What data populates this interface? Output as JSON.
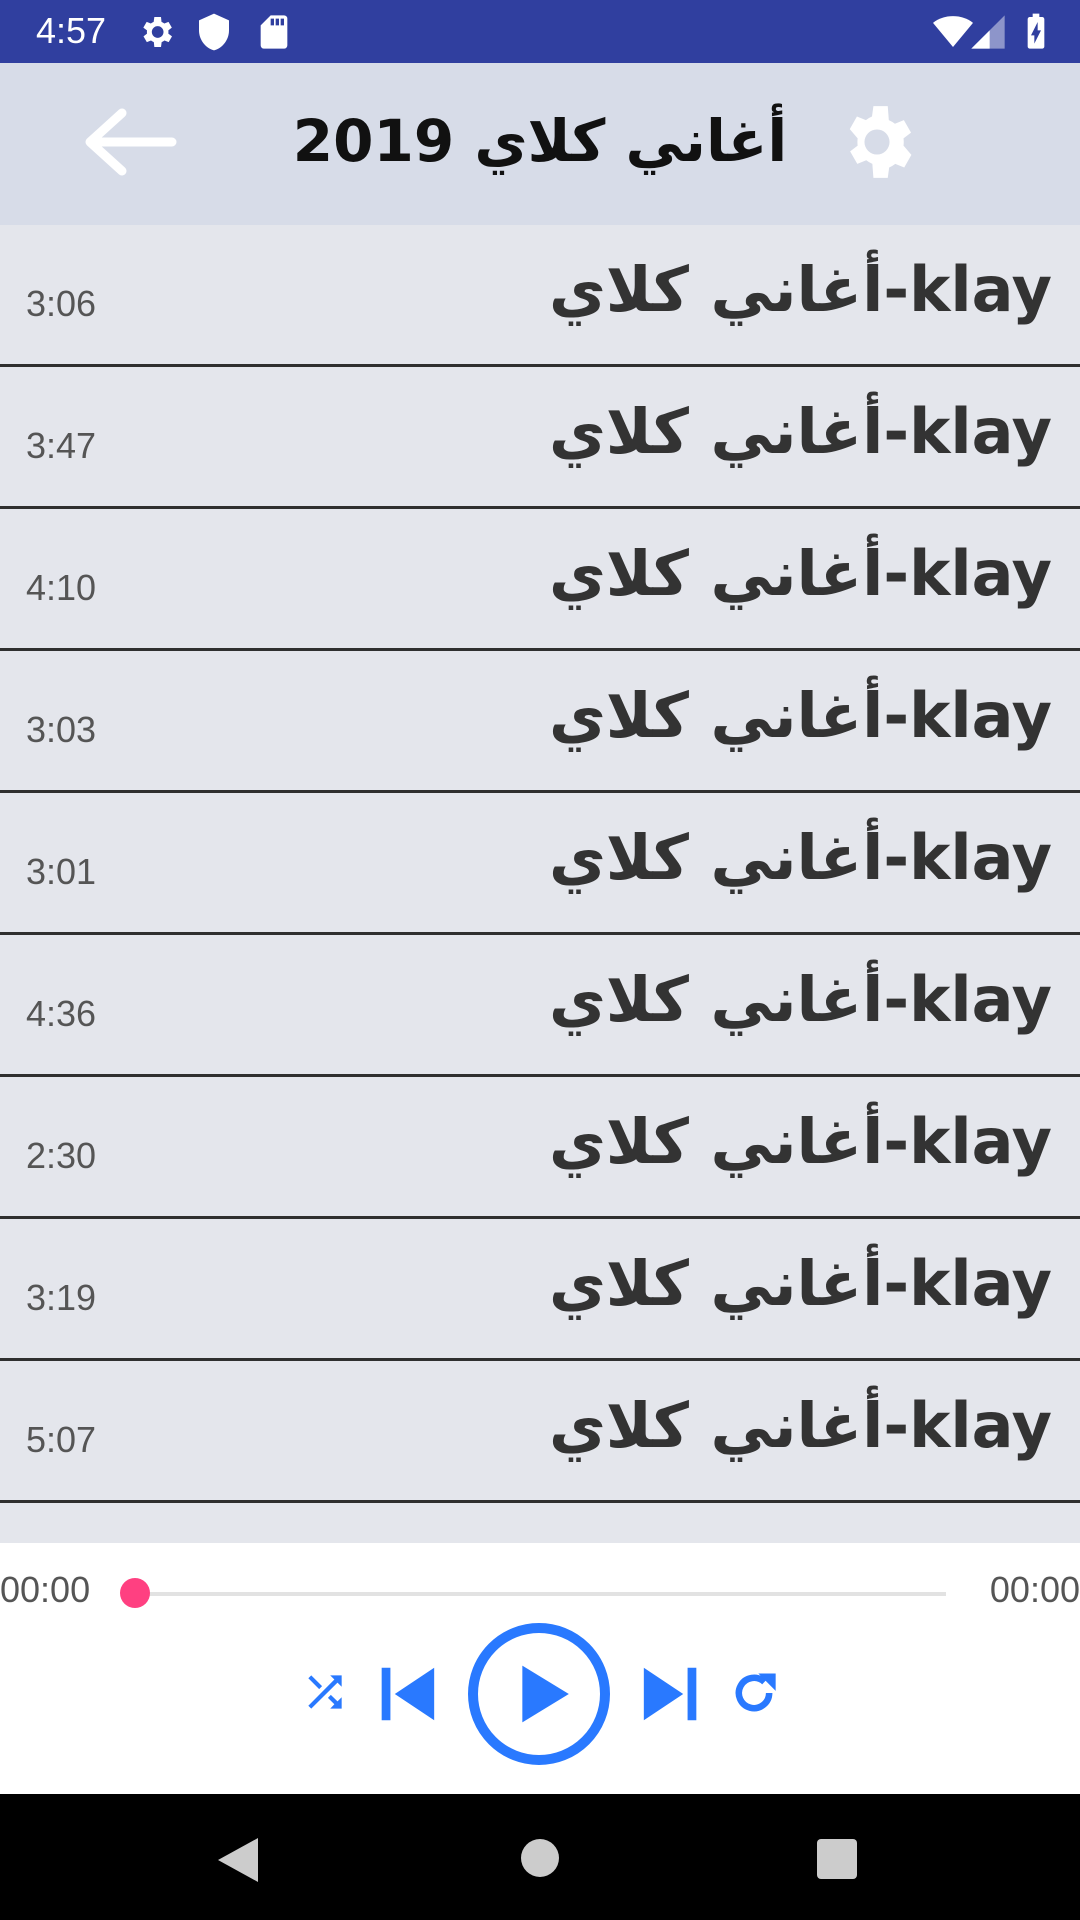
{
  "status_bar": {
    "time": "4:57",
    "icons": [
      "gear-icon",
      "shield-icon",
      "sd-card-icon",
      "wifi-icon",
      "signal-icon",
      "battery-icon"
    ]
  },
  "app_bar": {
    "title": "أغاني كلاي 2019",
    "back_icon": "arrow-left-icon",
    "settings_icon": "gear-icon"
  },
  "tracks": [
    {
      "title": "klay-أغاني كلاي",
      "duration": "3:06"
    },
    {
      "title": "klay-أغاني كلاي",
      "duration": "3:47"
    },
    {
      "title": "klay-أغاني كلاي",
      "duration": "4:10"
    },
    {
      "title": "klay-أغاني كلاي",
      "duration": "3:03"
    },
    {
      "title": "klay-أغاني كلاي",
      "duration": "3:01"
    },
    {
      "title": "klay-أغاني كلاي",
      "duration": "4:36"
    },
    {
      "title": "klay-أغاني كلاي",
      "duration": "2:30"
    },
    {
      "title": "klay-أغاني كلاي",
      "duration": "3:19"
    },
    {
      "title": "klay-أغاني كلاي",
      "duration": "5:07"
    }
  ],
  "player": {
    "elapsed": "00:00",
    "total": "00:00",
    "progress": 0,
    "controls": [
      "shuffle-icon",
      "previous-icon",
      "play-icon",
      "next-icon",
      "repeat-icon"
    ]
  },
  "colors": {
    "status_bar": "#303f9f",
    "app_bar": "#d7dce8",
    "list_bg": "#e4e6ec",
    "accent": "#2979ff",
    "seek_thumb": "#ff4081"
  },
  "nav_bar": {
    "buttons": [
      "back-triangle-icon",
      "home-circle-icon",
      "recents-square-icon"
    ]
  }
}
